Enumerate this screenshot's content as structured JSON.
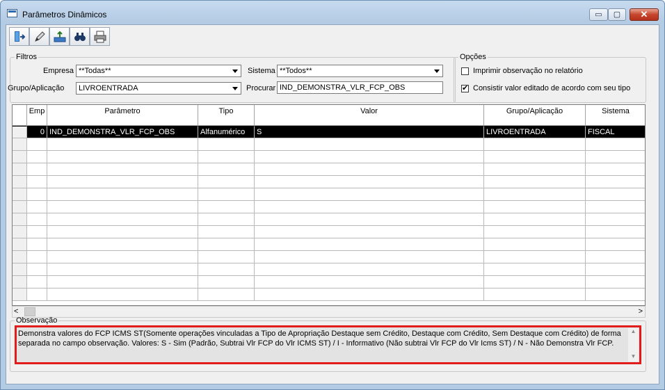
{
  "window": {
    "title": "Parâmetros Dinâmicos"
  },
  "titlebar": {
    "minimize": "▭",
    "maximize": "▢",
    "close": "✕"
  },
  "toolbar": {
    "buttons": [
      "exit-icon",
      "edit-icon",
      "export-icon",
      "find-icon",
      "print-icon"
    ]
  },
  "filtros": {
    "legend": "Filtros",
    "empresa_label": "Empresa",
    "empresa_value": "**Todas**",
    "sistema_label": "Sistema",
    "sistema_value": "**Todos**",
    "grupo_label": "Grupo/Aplicação",
    "grupo_value": "LIVROENTRADA",
    "procurar_label": "Procurar",
    "procurar_value": "IND_DEMONSTRA_VLR_FCP_OBS"
  },
  "opcoes": {
    "legend": "Opções",
    "imprimir_label": "Imprimir observação no relatório",
    "imprimir_checked": false,
    "consistir_label": "Consistir valor editado de acordo com seu tipo",
    "consistir_checked": true
  },
  "grid": {
    "columns": [
      "Emp",
      "Parâmetro",
      "Tipo",
      "Valor",
      "Grupo/Aplicação",
      "Sistema"
    ],
    "rows": [
      {
        "emp": "0",
        "parametro": "IND_DEMONSTRA_VLR_FCP_OBS",
        "tipo": "Alfanumérico",
        "valor": "S",
        "grupo": "LIVROENTRADA",
        "sistema": "FISCAL",
        "selected": true
      }
    ],
    "empty_rows": 13
  },
  "scrollbar": {
    "left": "<",
    "right": ">"
  },
  "observacao": {
    "legend": "Observação",
    "text": "Demonstra valores do FCP ICMS ST(Somente operações vinculadas a Tipo de Apropriação Destaque sem Crédito, Destaque com Crédito, Sem Destaque com Crédito) de forma separada no campo observação. Valores: S - Sim (Padrão, Subtrai Vlr FCP do Vlr ICMS ST) / I - Informativo (Não subtrai Vlr FCP do Vlr Icms ST) /  N - Não Demonstra Vlr FCP."
  },
  "colors": {
    "highlight": "#e21b1b",
    "selected_row": "#000000"
  }
}
